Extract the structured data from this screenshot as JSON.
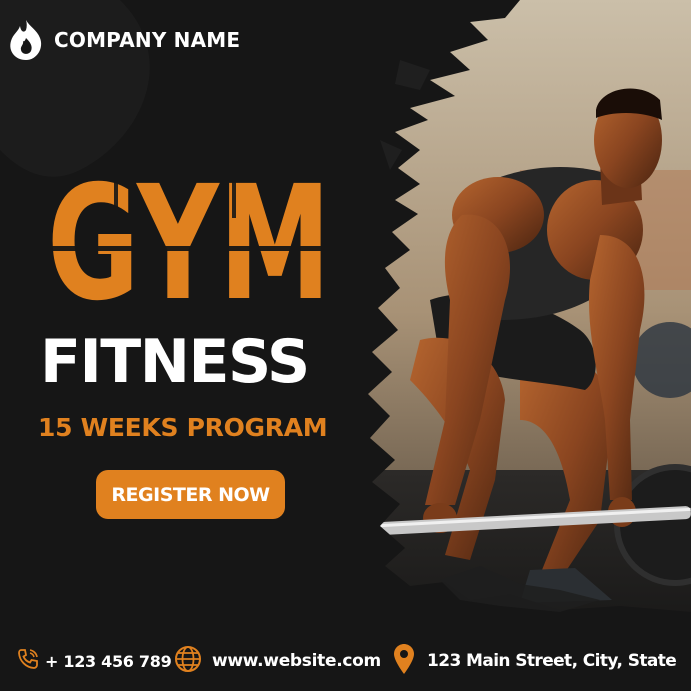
{
  "brand": {
    "company_name": "COMPANY NAME",
    "logo_icon": "flame-logo-icon"
  },
  "headline": {
    "title": "GYM",
    "subtitle": "FITNESS",
    "program": "15 WEEKS PROGRAM"
  },
  "cta": {
    "label": "REGISTER NOW"
  },
  "contact": {
    "phone": "+ 123 456 789",
    "phone_icon": "phone-icon",
    "website": "www.website.com",
    "website_icon": "globe-icon",
    "address": "123 Main Street, City, State",
    "address_icon": "location-pin-icon"
  },
  "colors": {
    "background": "#161616",
    "accent": "#e0811f",
    "text": "#ffffff"
  }
}
